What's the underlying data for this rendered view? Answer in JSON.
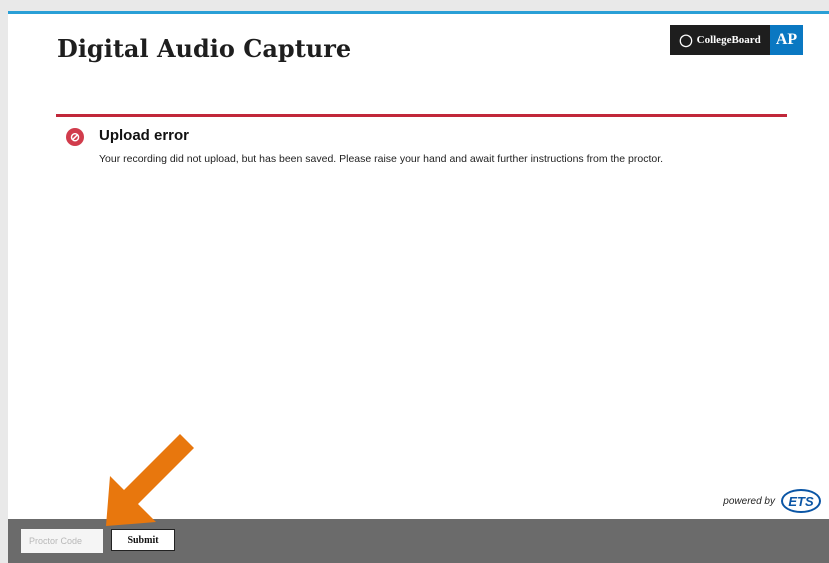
{
  "header": {
    "brand_collegeboard": "CollegeBoard",
    "brand_ap": "AP",
    "title": "Digital Audio Capture"
  },
  "alert": {
    "icon": "error-circle-icon",
    "title": "Upload error",
    "message": "Your recording did not upload, but has been saved. Please raise your hand and await further instructions from the proctor."
  },
  "branding": {
    "powered_by": "powered by",
    "ets": "ETS"
  },
  "footer": {
    "proctor_placeholder": "Proctor Code",
    "proctor_value": "",
    "submit_label": "Submit"
  },
  "colors": {
    "accent_blue": "#2a9fd6",
    "error_red": "#c1273a",
    "ap_blue": "#0a78c2",
    "annotation_arrow": "#e8770d",
    "footer_gray": "#6b6b6b"
  }
}
